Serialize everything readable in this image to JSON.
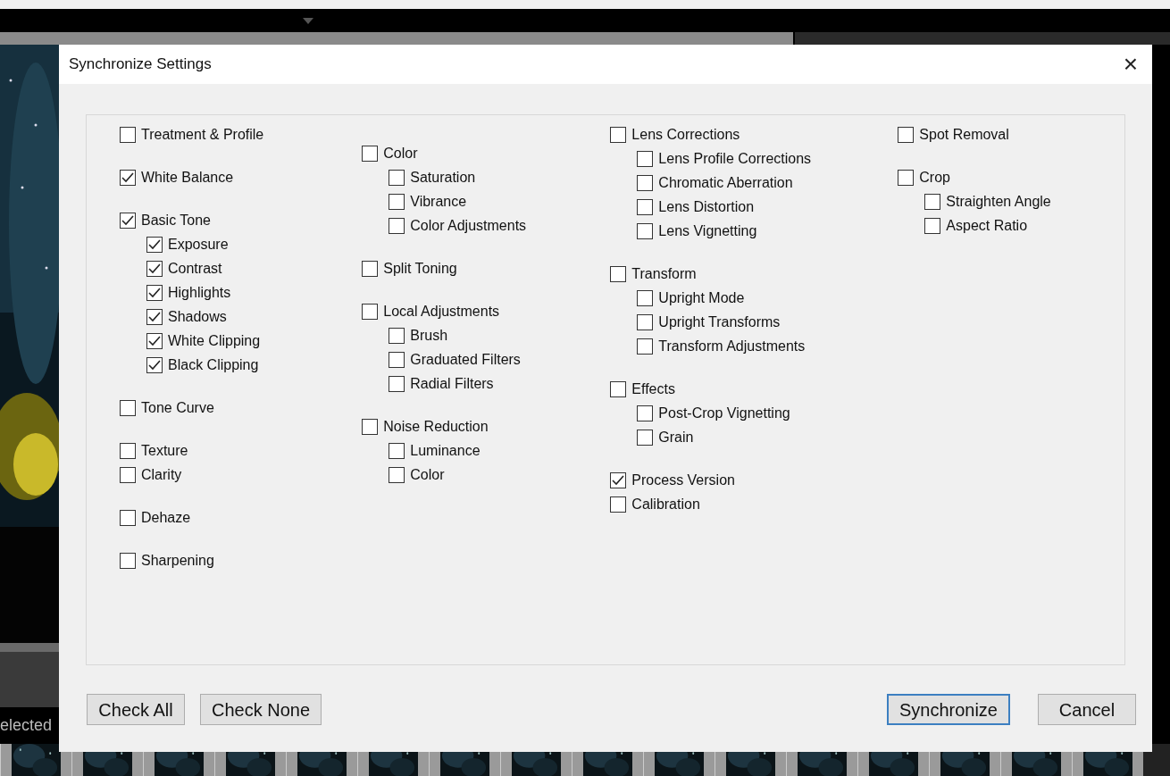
{
  "background": {
    "status_text": "elected"
  },
  "dialog": {
    "title": "Synchronize Settings",
    "close": "×",
    "columns": [
      {
        "groups": [
          [
            {
              "label": "Treatment & Profile",
              "checked": false
            }
          ],
          [
            {
              "label": "White Balance",
              "checked": true
            }
          ],
          [
            {
              "label": "Basic Tone",
              "checked": true,
              "children": [
                {
                  "label": "Exposure",
                  "checked": true
                },
                {
                  "label": "Contrast",
                  "checked": true
                },
                {
                  "label": "Highlights",
                  "checked": true
                },
                {
                  "label": "Shadows",
                  "checked": true
                },
                {
                  "label": "White Clipping",
                  "checked": true
                },
                {
                  "label": "Black Clipping",
                  "checked": true
                }
              ]
            }
          ],
          [
            {
              "label": "Tone Curve",
              "checked": false
            }
          ],
          [
            {
              "label": "Texture",
              "checked": false
            },
            {
              "label": "Clarity",
              "checked": false
            }
          ],
          [
            {
              "label": "Dehaze",
              "checked": false
            }
          ],
          [
            {
              "label": "Sharpening",
              "checked": false
            }
          ]
        ]
      },
      {
        "groups": [
          [
            {
              "label": "Color",
              "checked": false,
              "children": [
                {
                  "label": "Saturation",
                  "checked": false
                },
                {
                  "label": "Vibrance",
                  "checked": false
                },
                {
                  "label": "Color Adjustments",
                  "checked": false
                }
              ]
            }
          ],
          [
            {
              "label": "Split Toning",
              "checked": false
            }
          ],
          [
            {
              "label": "Local Adjustments",
              "checked": false,
              "children": [
                {
                  "label": "Brush",
                  "checked": false
                },
                {
                  "label": "Graduated Filters",
                  "checked": false
                },
                {
                  "label": "Radial Filters",
                  "checked": false
                }
              ]
            }
          ],
          [
            {
              "label": "Noise Reduction",
              "checked": false,
              "children": [
                {
                  "label": "Luminance",
                  "checked": false
                },
                {
                  "label": "Color",
                  "checked": false
                }
              ]
            }
          ]
        ]
      },
      {
        "groups": [
          [
            {
              "label": "Lens Corrections",
              "checked": false,
              "children": [
                {
                  "label": "Lens Profile Corrections",
                  "checked": false
                },
                {
                  "label": "Chromatic Aberration",
                  "checked": false
                },
                {
                  "label": "Lens Distortion",
                  "checked": false
                },
                {
                  "label": "Lens Vignetting",
                  "checked": false
                }
              ]
            }
          ],
          [
            {
              "label": "Transform",
              "checked": false,
              "children": [
                {
                  "label": "Upright Mode",
                  "checked": false
                },
                {
                  "label": "Upright Transforms",
                  "checked": false
                },
                {
                  "label": "Transform Adjustments",
                  "checked": false
                }
              ]
            }
          ],
          [
            {
              "label": "Effects",
              "checked": false,
              "children": [
                {
                  "label": "Post-Crop Vignetting",
                  "checked": false
                },
                {
                  "label": "Grain",
                  "checked": false
                }
              ]
            }
          ],
          [
            {
              "label": "Process Version",
              "checked": true
            },
            {
              "label": "Calibration",
              "checked": false
            }
          ]
        ]
      },
      {
        "groups": [
          [
            {
              "label": "Spot Removal",
              "checked": false
            }
          ],
          [
            {
              "label": "Crop",
              "checked": false,
              "children": [
                {
                  "label": "Straighten Angle",
                  "checked": false
                },
                {
                  "label": "Aspect Ratio",
                  "checked": false
                }
              ]
            }
          ]
        ]
      }
    ],
    "left_buttons": [
      {
        "label": "Check All",
        "default": false
      },
      {
        "label": "Check None",
        "default": false
      }
    ],
    "right_buttons": [
      {
        "label": "Synchronize",
        "default": true
      },
      {
        "label": "Cancel",
        "default": false
      }
    ]
  }
}
